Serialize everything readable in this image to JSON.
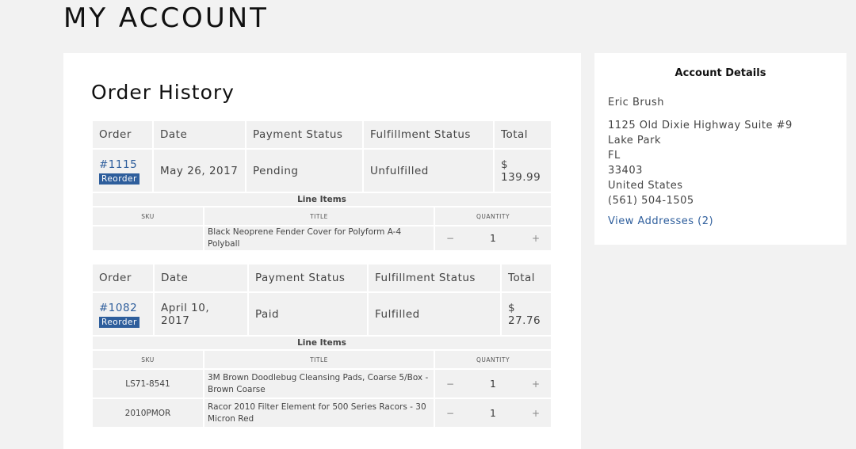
{
  "page": {
    "title": "MY ACCOUNT"
  },
  "order_history": {
    "title": "Order History",
    "columns": [
      "Order",
      "Date",
      "Payment Status",
      "Fulfillment Status",
      "Total"
    ],
    "line_items_label": "Line Items",
    "line_item_columns": [
      "SKU",
      "TITLE",
      "QUANTITY"
    ],
    "reorder_label": "Reorder",
    "orders": [
      {
        "number": "#1115",
        "date": "May 26, 2017",
        "payment_status": "Pending",
        "fulfillment_status": "Unfulfilled",
        "total": "$ 139.99",
        "line_items": [
          {
            "sku": "",
            "title": "Black Neoprene Fender Cover for Polyform A-4 Polyball",
            "quantity": "1"
          }
        ]
      },
      {
        "number": "#1082",
        "date": "April 10, 2017",
        "payment_status": "Paid",
        "fulfillment_status": "Fulfilled",
        "total": "$ 27.76",
        "line_items": [
          {
            "sku": "LS71-8541",
            "title": "3M Brown Doodlebug Cleansing Pads, Coarse 5/Box - Brown Coarse",
            "quantity": "1"
          },
          {
            "sku": "2010PMOR",
            "title": "Racor 2010 Filter Element for 500 Series Racors - 30 Micron Red",
            "quantity": "1"
          }
        ]
      }
    ]
  },
  "qty_controls": {
    "minus": "−",
    "plus": "+"
  },
  "account_details": {
    "title": "Account Details",
    "name": "Eric Brush",
    "address": [
      "1125 Old Dixie Highway Suite #9",
      "Lake Park",
      "FL",
      "33403",
      "United States",
      "(561) 504-1505"
    ],
    "view_addresses": "View Addresses (2)"
  },
  "colors": {
    "link": "#2e5e9c",
    "badge": "#2e5e9c",
    "page_bg": "#f2f2f2",
    "cell_bg": "#f1f1f1"
  }
}
